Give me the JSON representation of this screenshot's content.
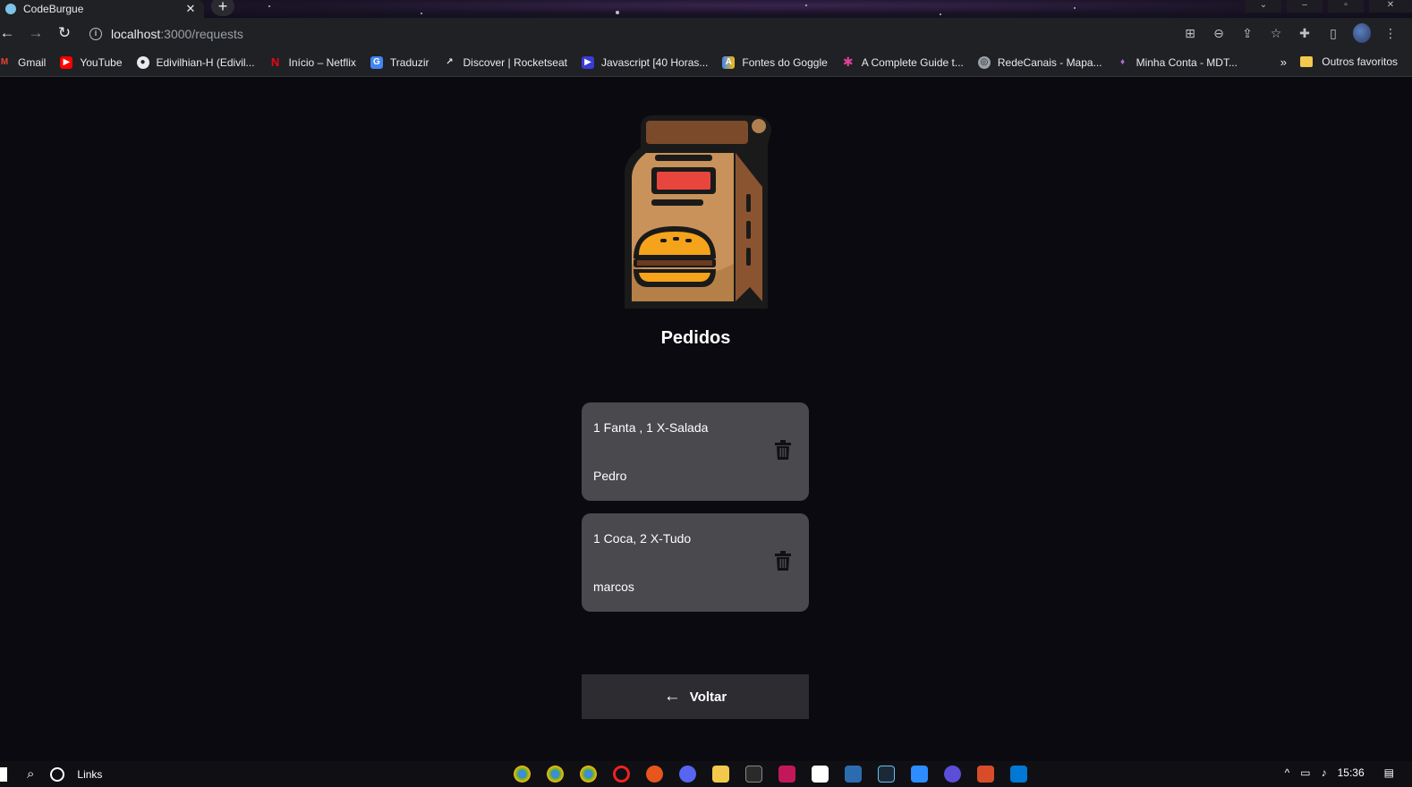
{
  "browser": {
    "tab_title": "CodeBurgue",
    "url_host": "localhost",
    "url_path": ":3000/requests",
    "bookmarks": [
      {
        "label": "Gmail",
        "icon": "gmail-icon",
        "color": "#ea4335"
      },
      {
        "label": "YouTube",
        "icon": "youtube-icon",
        "color": "#ff0000"
      },
      {
        "label": "Edivilhian-H (Edivil...",
        "icon": "github-icon",
        "color": "#e8eaed"
      },
      {
        "label": "Início – Netflix",
        "icon": "netflix-icon",
        "color": "#e50914"
      },
      {
        "label": "Traduzir",
        "icon": "translate-icon",
        "color": "#4285f4"
      },
      {
        "label": "Discover | Rocketseat",
        "icon": "rocketseat-icon",
        "color": "#8257e5"
      },
      {
        "label": "Javascript [40 Horas...",
        "icon": "javascript-icon",
        "color": "#3b3bd8"
      },
      {
        "label": "Fontes do Goggle",
        "icon": "google-fonts-icon",
        "color": "#fbbc04"
      },
      {
        "label": "A Complete Guide t...",
        "icon": "css-tricks-icon",
        "color": "#e0409a"
      },
      {
        "label": "RedeCanais - Mapa...",
        "icon": "globe-icon",
        "color": "#9aa0a6"
      },
      {
        "label": "Minha Conta - MDT...",
        "icon": "mdt-icon",
        "color": "#b06ad8"
      }
    ],
    "more_bookmarks": "»",
    "other_bookmarks": "Outros favoritos"
  },
  "page": {
    "title": "Pedidos",
    "orders": [
      {
        "items": "1 Fanta , 1 X-Salada",
        "client": "Pedro"
      },
      {
        "items": "1 Coca, 2 X-Tudo",
        "client": "marcos"
      }
    ],
    "back_label": "Voltar"
  },
  "taskbar": {
    "search_label": "Links",
    "time": "15:36"
  },
  "colors": {
    "background": "#0b0a10",
    "card": "#49494e",
    "back_button": "#2c2c31"
  }
}
